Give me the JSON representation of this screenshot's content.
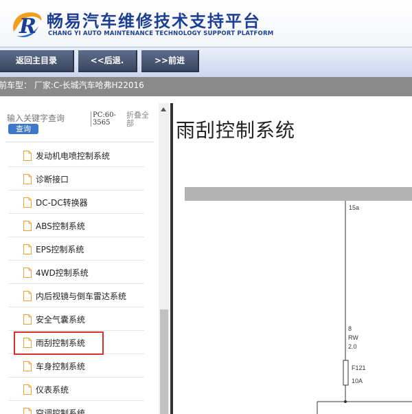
{
  "header": {
    "title_cn": "畅易汽车维修技术支持平台",
    "title_en": "CHANG YI AUTO MAINTENANCE TECHNOLOGY SUPPORT PLATFORM"
  },
  "nav": {
    "home_label": "返回主目录",
    "back_label": "<<后退.",
    "forward_label": ">>前进"
  },
  "info": {
    "current_model": "前车型： 厂家:C-长城汽车哈弗H22016"
  },
  "sidebar": {
    "search_placeholder": "输入关键字查询",
    "search_button": "查询",
    "pc_info": "PC:60-3565",
    "collapse_label": "折叠全部",
    "items": [
      {
        "label": "发动机电喷控制系统"
      },
      {
        "label": "诊断接口"
      },
      {
        "label": "DC-DC转换器"
      },
      {
        "label": "ABS控制系统"
      },
      {
        "label": "EPS控制系统"
      },
      {
        "label": "4WD控制系统"
      },
      {
        "label": "内后视镜与倒车雷达系统"
      },
      {
        "label": "安全气囊系统"
      },
      {
        "label": "雨刮控制系统"
      },
      {
        "label": "车身控制系统"
      },
      {
        "label": "仪表系统"
      },
      {
        "label": "空调控制系统"
      }
    ],
    "selected_item": "雨刮控制系统"
  },
  "diagram": {
    "title": "雨刮控制系统",
    "labels": {
      "wire_top": "15a",
      "pin": "8",
      "wire_color": "RW",
      "wire_size": "2.0",
      "fuse_name": "F121",
      "fuse_rating": "10A"
    }
  },
  "colors": {
    "brand_blue": "#1c3f95",
    "nav_button": "#4a5670",
    "highlight": "#d9302c",
    "info_bar": "#8a8a8a"
  }
}
